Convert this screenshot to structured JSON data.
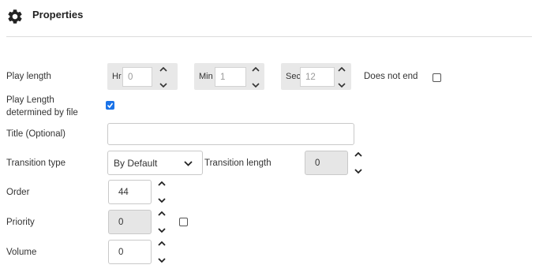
{
  "header": {
    "title": "Properties",
    "icon": "gear-icon"
  },
  "play_length": {
    "label": "Play length",
    "hours": {
      "prefix": "Hr",
      "value": "0"
    },
    "minutes": {
      "prefix": "Min",
      "value": "1"
    },
    "seconds": {
      "prefix": "Sec",
      "value": "12"
    },
    "does_not_end_label": "Does not end",
    "does_not_end_checked": false
  },
  "determined_by_file": {
    "label_line1": "Play Length",
    "label_line2": "determined by file",
    "checked": true
  },
  "title_field": {
    "label": "Title (Optional)",
    "value": ""
  },
  "transition": {
    "type_label": "Transition type",
    "type_value": "By Default",
    "length_label": "Transition length",
    "length_value": "0"
  },
  "order": {
    "label": "Order",
    "value": "44"
  },
  "priority": {
    "label": "Priority",
    "value": "0",
    "checked": false
  },
  "volume": {
    "label": "Volume",
    "value": "0"
  },
  "colors": {
    "accent": "#1a73e8",
    "panel": "#e8e8e8",
    "disabled_field": "#e6e6e6"
  }
}
